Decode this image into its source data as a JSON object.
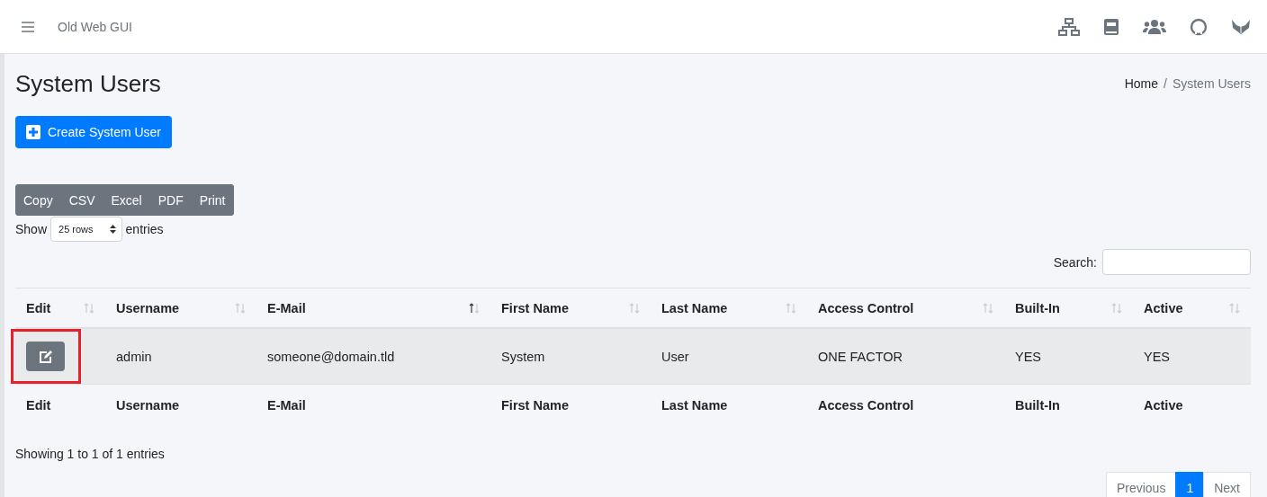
{
  "navbar": {
    "title": "Old Web GUI"
  },
  "page": {
    "title": "System Users",
    "breadcrumb": [
      {
        "label": "Home"
      },
      {
        "label": "System Users"
      }
    ],
    "breadcrumb_separator": "/",
    "create_button": "Create System User"
  },
  "export_buttons": [
    "Copy",
    "CSV",
    "Excel",
    "PDF",
    "Print"
  ],
  "length": {
    "prefix": "Show",
    "value": "25 rows",
    "suffix": "entries"
  },
  "search": {
    "label": "Search:"
  },
  "table": {
    "columns": [
      {
        "label": "Edit",
        "sorted_ascending": false
      },
      {
        "label": "Username",
        "sorted_ascending": false
      },
      {
        "label": "E-Mail",
        "sorted_ascending": true
      },
      {
        "label": "First Name",
        "sorted_ascending": false
      },
      {
        "label": "Last Name",
        "sorted_ascending": false
      },
      {
        "label": "Access Control",
        "sorted_ascending": false
      },
      {
        "label": "Built-In",
        "sorted_ascending": false
      },
      {
        "label": "Active",
        "sorted_ascending": false
      }
    ],
    "rows": [
      {
        "highlighted": true,
        "cells": [
          "",
          "admin",
          "someone@domain.tld",
          "System",
          "User",
          "ONE FACTOR",
          "YES",
          "YES"
        ]
      }
    ],
    "footer": [
      "Edit",
      "Username",
      "E-Mail",
      "First Name",
      "Last Name",
      "Access Control",
      "Built-In",
      "Active"
    ]
  },
  "info": "Showing 1 to 1 of 1 entries",
  "pagination": [
    {
      "label": "Previous",
      "selected": false
    },
    {
      "label": "1",
      "selected": true
    },
    {
      "label": "Next",
      "selected": false
    }
  ]
}
